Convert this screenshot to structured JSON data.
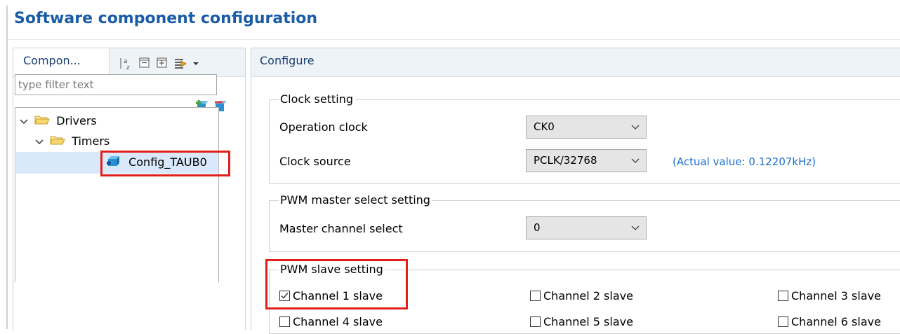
{
  "title": "Software component configuration",
  "left_panel": {
    "tab_label": "Compon...",
    "toolbar": {
      "sort_icon": "sort-az-icon",
      "collapse_icon": "collapse-all-icon",
      "expand_icon": "expand-all-icon",
      "filter_icon": "filter-icon",
      "menu_icon": "view-menu-icon"
    },
    "add_icon": "add-component-icon",
    "remove_icon": "remove-component-icon",
    "filter_placeholder": "type filter text",
    "tree": [
      {
        "label": "Drivers",
        "expanded": true,
        "depth": 0
      },
      {
        "label": "Timers",
        "expanded": true,
        "depth": 1
      },
      {
        "label": "Config_TAUB0",
        "selected": true,
        "depth": 2
      }
    ]
  },
  "right_panel": {
    "tab_label": "Configure",
    "clock_setting": {
      "legend": "Clock setting",
      "operation_clock_label": "Operation clock",
      "operation_clock_value": "CK0",
      "clock_source_label": "Clock source",
      "clock_source_value": "PCLK/32768",
      "actual_value": "(Actual value: 0.12207kHz)"
    },
    "pwm_master": {
      "legend": "PWM master select setting",
      "master_channel_label": "Master channel select",
      "master_channel_value": "0"
    },
    "pwm_slave": {
      "legend": "PWM slave setting",
      "channels": [
        {
          "label": "Channel 1 slave",
          "checked": true
        },
        {
          "label": "Channel 2 slave",
          "checked": false
        },
        {
          "label": "Channel 3 slave",
          "checked": false
        },
        {
          "label": "Channel 4 slave",
          "checked": false
        },
        {
          "label": "Channel 5 slave",
          "checked": false
        },
        {
          "label": "Channel 6 slave",
          "checked": false
        }
      ]
    }
  },
  "colors": {
    "title": "#1a5ca8",
    "highlight_box": "#e0201b",
    "selection": "#d9e8fb",
    "actual_value": "#1b6dcf"
  }
}
